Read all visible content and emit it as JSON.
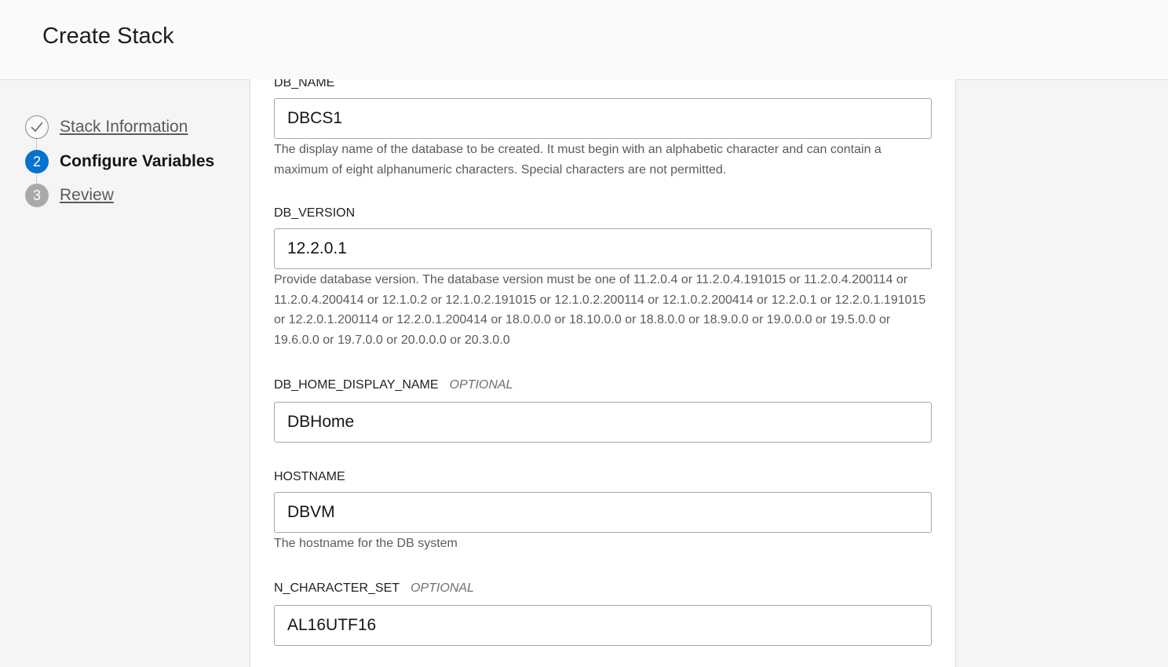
{
  "header": {
    "title": "Create Stack"
  },
  "steps": [
    {
      "number": "",
      "label": "Stack Information",
      "state": "completed",
      "icon": "check-icon"
    },
    {
      "number": "2",
      "label": "Configure Variables",
      "state": "current"
    },
    {
      "number": "3",
      "label": "Review",
      "state": "upcoming"
    }
  ],
  "fields": [
    {
      "label": "DB_NAME",
      "optional": "",
      "value": "DBCS1",
      "help": "The display name of the database to be created. It must begin with an alphabetic character and can contain a maximum of eight alphanumeric characters. Special characters are not permitted."
    },
    {
      "label": "DB_VERSION",
      "optional": "",
      "value": "12.2.0.1",
      "help": "Provide database version. The database version must be one of 11.2.0.4 or 11.2.0.4.191015 or 11.2.0.4.200114 or 11.2.0.4.200414 or 12.1.0.2 or 12.1.0.2.191015 or 12.1.0.2.200114 or 12.1.0.2.200414 or 12.2.0.1 or 12.2.0.1.191015 or 12.2.0.1.200114 or 12.2.0.1.200414 or 18.0.0.0 or 18.10.0.0 or 18.8.0.0 or 18.9.0.0 or 19.0.0.0 or 19.5.0.0 or 19.6.0.0 or 19.7.0.0 or 20.0.0.0 or 20.3.0.0"
    },
    {
      "label": "DB_HOME_DISPLAY_NAME",
      "optional": "OPTIONAL",
      "value": "DBHome",
      "help": ""
    },
    {
      "label": "HOSTNAME",
      "optional": "",
      "value": "DBVM",
      "help": "The hostname for the DB system"
    },
    {
      "label": "N_CHARACTER_SET",
      "optional": "OPTIONAL",
      "value": "AL16UTF16",
      "help": ""
    }
  ],
  "colors": {
    "accent": "#0572ce",
    "upcoming": "#a9a9a9"
  }
}
